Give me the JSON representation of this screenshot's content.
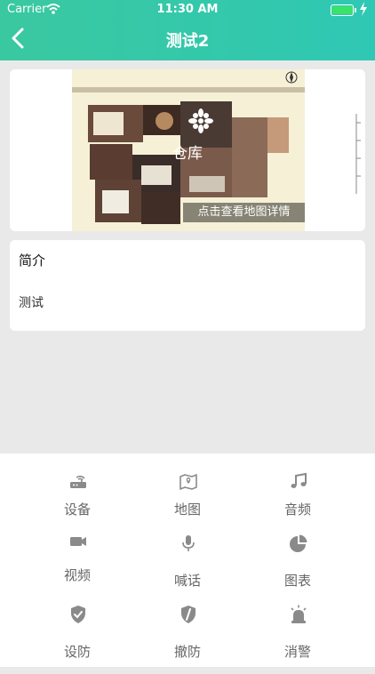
{
  "status": {
    "carrier": "Carrier",
    "time": "11:30 AM",
    "battery_level": 0.95
  },
  "header": {
    "title": "测试2"
  },
  "map": {
    "label": "仓库",
    "hint": "点击查看地图详情"
  },
  "intro": {
    "title": "简介",
    "body": "测试"
  },
  "grid": [
    {
      "label": "设备",
      "icon": "router-icon"
    },
    {
      "label": "地图",
      "icon": "map-icon"
    },
    {
      "label": "音频",
      "icon": "music-note-icon"
    },
    {
      "label": "视频",
      "icon": "video-camera-icon"
    },
    {
      "label": "喊话",
      "icon": "microphone-icon"
    },
    {
      "label": "图表",
      "icon": "pie-chart-icon"
    },
    {
      "label": "设防",
      "icon": "shield-check-icon"
    },
    {
      "label": "撤防",
      "icon": "shield-slash-icon"
    },
    {
      "label": "消警",
      "icon": "alarm-siren-icon"
    }
  ],
  "colors": {
    "header": "#34c8a8",
    "icon": "#8a8a8a",
    "label": "#666666"
  }
}
